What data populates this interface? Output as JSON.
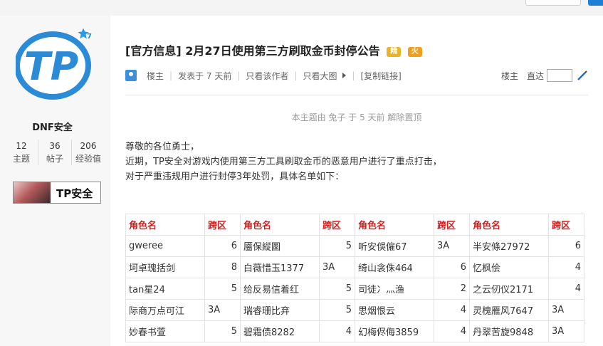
{
  "window": {
    "title": "[官方信息] 2月27日使用第三方刷取金币封停公告"
  },
  "sidebar": {
    "logo_text": "TP",
    "star_suffix": "7",
    "username": "DNF安全",
    "stats": [
      {
        "value": "12",
        "label": "主题"
      },
      {
        "value": "36",
        "label": "帖子"
      },
      {
        "value": "206",
        "label": "经验值"
      }
    ],
    "badge_text": "TP安全"
  },
  "post": {
    "tag": "[官方信息]",
    "title": "2月27日使用第三方刷取金币封停公告",
    "icon_jing": "精",
    "icon_huo": "火",
    "meta": {
      "floor": "楼主",
      "posted": "发表于 7 天前",
      "author_only": "只看该作者",
      "big_image": "只看大图",
      "copy_link": "[复制链接]"
    },
    "right_meta": {
      "floor": "楼主",
      "goto": "直达"
    },
    "notice": "本主题由 兔子 于 5 天前 解除置顶",
    "body": [
      "尊敬的各位勇士，",
      "近期，TP安全对游戏内使用第三方工具刷取金币的恶意用户进行了重点打击，",
      "对于严重违规用户进行封停3年处罚，具体名单如下："
    ]
  },
  "table": {
    "headers": [
      "角色名",
      "跨区",
      "角色名",
      "跨区",
      "角色名",
      "跨区",
      "角色名",
      "跨区"
    ],
    "rows": [
      [
        "gweree",
        "6",
        "靥保縱圖",
        "5",
        "听安俁僱67",
        "3A",
        "半安條27972",
        "6"
      ],
      [
        "坷卓瑰括剑",
        "8",
        "白薇惜玉1377",
        "3A",
        "绮山衾侏464",
        "6",
        "忆枫侩",
        "4"
      ],
      [
        "tan星24",
        "5",
        "给反易信着红",
        "5",
        "司徒冫灬渔",
        "2",
        "之云仞仪2171",
        "4"
      ],
      [
        "际商万点可江",
        "3A",
        "瑞睿珊比弃",
        "5",
        "思烟恨云",
        "4",
        "灵槐雁风7647",
        "3A"
      ],
      [
        "妙春书萱",
        "5",
        "碧霜债8282",
        "4",
        "幻梅侭侮3859",
        "4",
        "丹翠苦旋9848",
        "3A"
      ]
    ]
  },
  "colors": {
    "header_red": "#d02020",
    "logo_blue": "#2b8bd6",
    "accent_blue": "#1e7fd6"
  },
  "icons": [
    "user-icon",
    "triangle-right-icon",
    "pen-icon",
    "star-icon"
  ]
}
